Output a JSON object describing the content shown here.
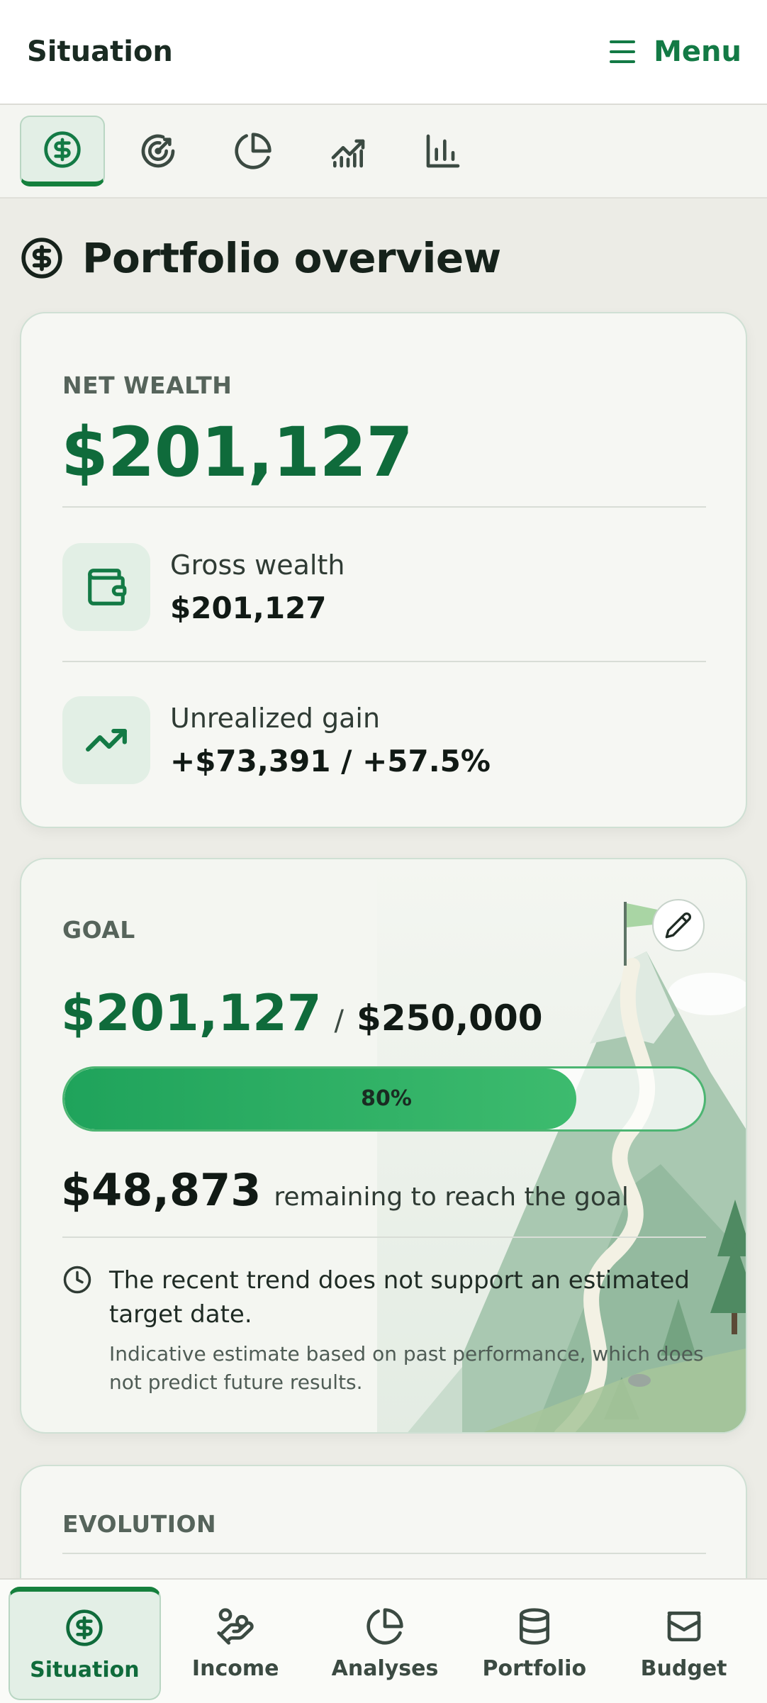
{
  "header": {
    "title": "Situation",
    "menu_label": "Menu"
  },
  "tabs": [
    {
      "icon": "dollar-circle-icon",
      "active": true
    },
    {
      "icon": "target-icon",
      "active": false
    },
    {
      "icon": "pie-chart-icon",
      "active": false
    },
    {
      "icon": "trend-chart-icon",
      "active": false
    },
    {
      "icon": "bar-chart-icon",
      "active": false
    }
  ],
  "page": {
    "title": "Portfolio overview"
  },
  "wealth": {
    "label": "NET WEALTH",
    "net_value": "$201,127",
    "gross_label": "Gross wealth",
    "gross_value": "$201,127",
    "gain_label": "Unrealized gain",
    "gain_value": "+$73,391 / +57.5%"
  },
  "goal": {
    "label": "GOAL",
    "current": "$201,127",
    "separator": "/",
    "target": "$250,000",
    "progress_pct": 80,
    "progress_label": "80%",
    "remaining_amount": "$48,873",
    "remaining_text": "remaining to reach the goal",
    "trend_text": "The recent trend does not support an estimated target date.",
    "disclaimer": "Indicative estimate based on past performance, which does not predict future results."
  },
  "evolution": {
    "label": "EVOLUTION"
  },
  "bottom_nav": [
    {
      "label": "Situation",
      "icon": "dollar-circle-icon",
      "active": true
    },
    {
      "label": "Income",
      "icon": "hand-coins-icon",
      "active": false
    },
    {
      "label": "Analyses",
      "icon": "pie-chart-icon",
      "active": false
    },
    {
      "label": "Portfolio",
      "icon": "database-icon",
      "active": false
    },
    {
      "label": "Budget",
      "icon": "wallet-box-icon",
      "active": false
    }
  ],
  "colors": {
    "accent": "#137a45",
    "value_green": "#0f6b3b",
    "progress": "#1fa35b",
    "background": "#ecece6"
  }
}
